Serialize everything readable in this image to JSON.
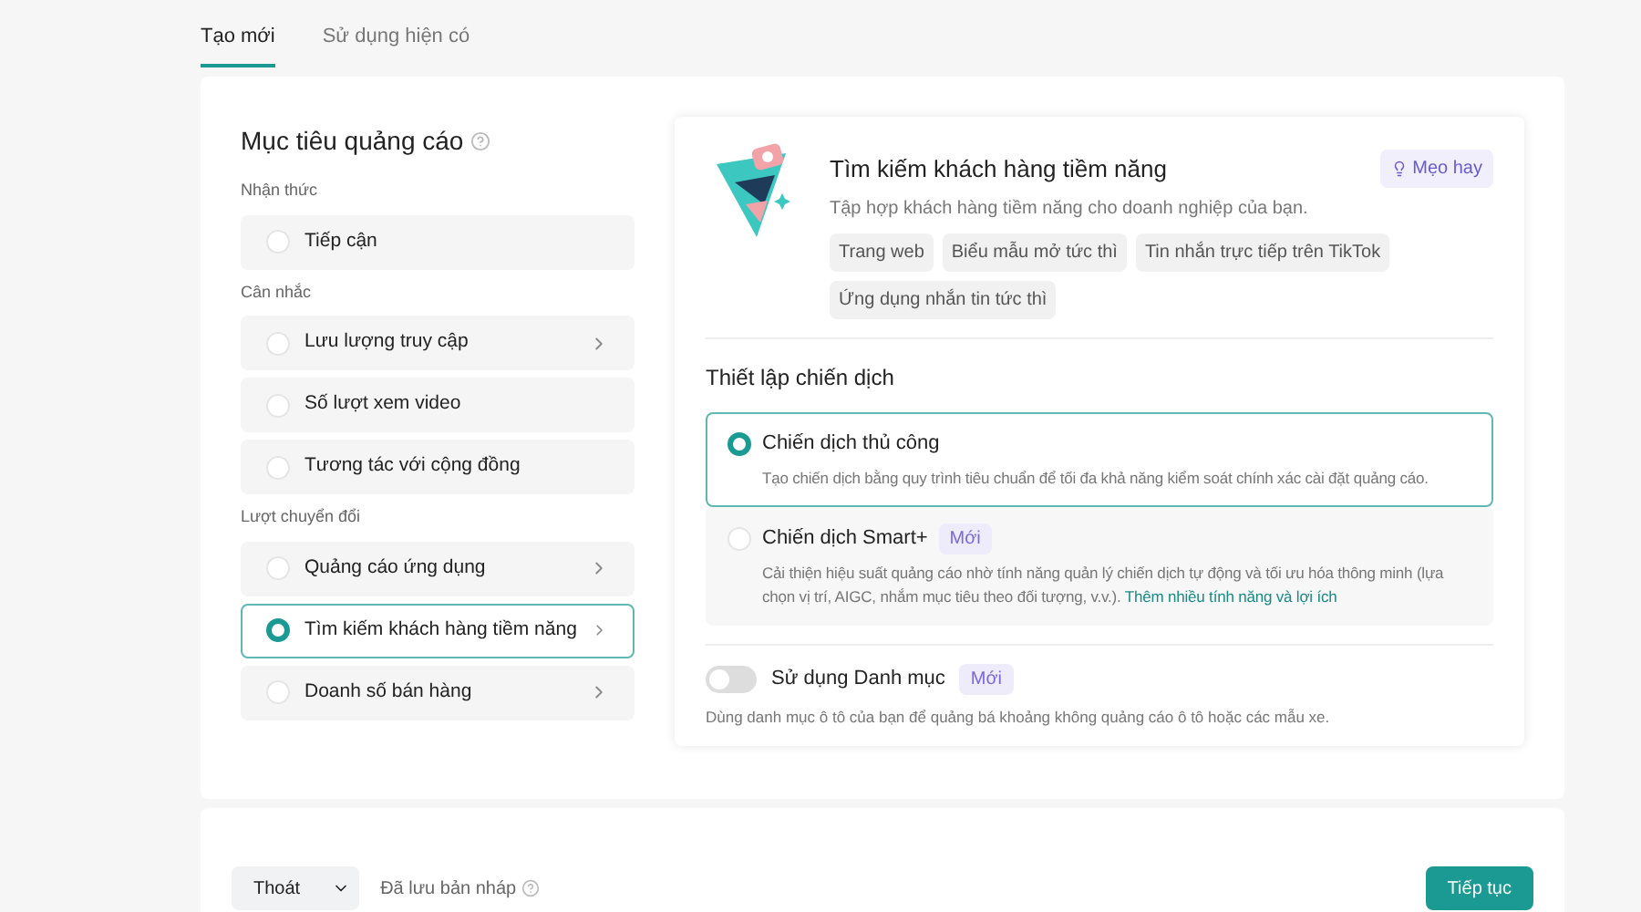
{
  "tabs": [
    {
      "label": "Tạo mới",
      "selected": true
    },
    {
      "label": "Sử dụng hiện có",
      "selected": false
    }
  ],
  "objective": {
    "title": "Mục tiêu quảng cáo",
    "groups": [
      {
        "label": "Nhận thức",
        "items": [
          {
            "label": "Tiếp cận",
            "selected": false,
            "has_chevron": false
          }
        ]
      },
      {
        "label": "Cân nhắc",
        "items": [
          {
            "label": "Lưu lượng truy cập",
            "selected": false,
            "has_chevron": true
          },
          {
            "label": "Số lượt xem video",
            "selected": false,
            "has_chevron": false
          },
          {
            "label": "Tương tác với cộng đồng",
            "selected": false,
            "has_chevron": false
          }
        ]
      },
      {
        "label": "Lượt chuyển đổi",
        "items": [
          {
            "label": "Quảng cáo ứng dụng",
            "selected": false,
            "has_chevron": true
          },
          {
            "label": "Tìm kiếm khách hàng tiềm năng",
            "selected": true,
            "has_chevron": true
          },
          {
            "label": "Doanh số bán hàng",
            "selected": false,
            "has_chevron": true
          }
        ]
      }
    ]
  },
  "detail": {
    "title": "Tìm kiếm khách hàng tiềm năng",
    "tip": "Mẹo hay",
    "description": "Tập hợp khách hàng tiềm năng cho doanh nghiệp của bạn.",
    "tags": [
      "Trang web",
      "Biểu mẫu mở tức thì",
      "Tin nhắn trực tiếp trên TikTok",
      "Ứng dụng nhắn tin tức thì"
    ]
  },
  "campaign_setup": {
    "title": "Thiết lập chiến dịch",
    "options": [
      {
        "title": "Chiến dịch thủ công",
        "selected": true,
        "description": "Tạo chiến dịch bằng quy trình tiêu chuẩn để tối đa khả năng kiểm soát chính xác cài đặt quảng cáo."
      },
      {
        "title": "Chiến dịch Smart+",
        "badge": "Mới",
        "selected": false,
        "description": "Cải thiện hiệu suất quảng cáo nhờ tính năng quản lý chiến dịch tự động và tối ưu hóa thông minh (lựa chọn vị trí, AIGC, nhắm mục tiêu theo đối tượng, v.v.).",
        "link": "Thêm nhiều tính năng và lợi ích"
      }
    ]
  },
  "catalog": {
    "label": "Sử dụng Danh mục",
    "badge": "Mới",
    "on": false,
    "description": "Dùng danh mục ô tô của bạn để quảng bá khoảng không quảng cáo ô tô hoặc các mẫu xe."
  },
  "footer": {
    "exit": "Thoát",
    "draft_status": "Đã lưu bản nháp",
    "continue": "Tiếp tục"
  }
}
